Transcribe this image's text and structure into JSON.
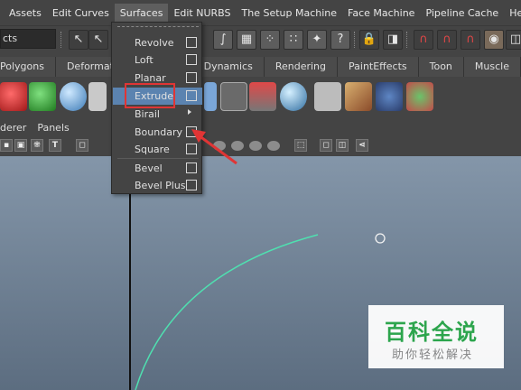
{
  "menubar": {
    "items": [
      "Assets",
      "Edit Curves",
      "Surfaces",
      "Edit NURBS",
      "The Setup Machine",
      "Face Machine",
      "Pipeline Cache",
      "Help"
    ],
    "active": "Surfaces"
  },
  "statusline": {
    "mode_value": "cts",
    "icons": [
      "select-hierarchy-icon",
      "select-object-icon",
      "select-component-icon",
      "snap-grid-icon",
      "snap-curve-icon",
      "snap-point-icon",
      "snap-view-icon",
      "snap-live-icon",
      "help-icon",
      "lock-icon",
      "select-lock-icon",
      "magnet-icon",
      "magnet-x-icon",
      "render-icon"
    ]
  },
  "shelf_tabs": [
    "Polygons",
    "Deformation",
    "",
    "Dynamics",
    "Rendering",
    "PaintEffects",
    "Toon",
    "Muscle"
  ],
  "panel_menu": {
    "items": [
      "derer",
      "Panels"
    ]
  },
  "surfaces_menu": {
    "items": [
      {
        "label": "Revolve",
        "has_option_box": true
      },
      {
        "label": "Loft",
        "has_option_box": true
      },
      {
        "label": "Planar",
        "has_option_box": true
      },
      {
        "label": "Extrude",
        "has_option_box": true,
        "highlighted": true
      },
      {
        "label": "Birail",
        "has_submenu": true
      },
      {
        "label": "Boundary",
        "has_option_box": true
      },
      {
        "label": "Square",
        "has_option_box": true
      },
      {
        "label": "Bevel",
        "has_option_box": true
      },
      {
        "label": "Bevel Plus",
        "has_option_box": true
      }
    ]
  },
  "watermark": {
    "title": "百科全说",
    "subtitle": "助你轻松解决"
  },
  "colors": {
    "highlight": "#5b83b0",
    "annotation": "#e03535",
    "curve": "#4fe0b0"
  }
}
